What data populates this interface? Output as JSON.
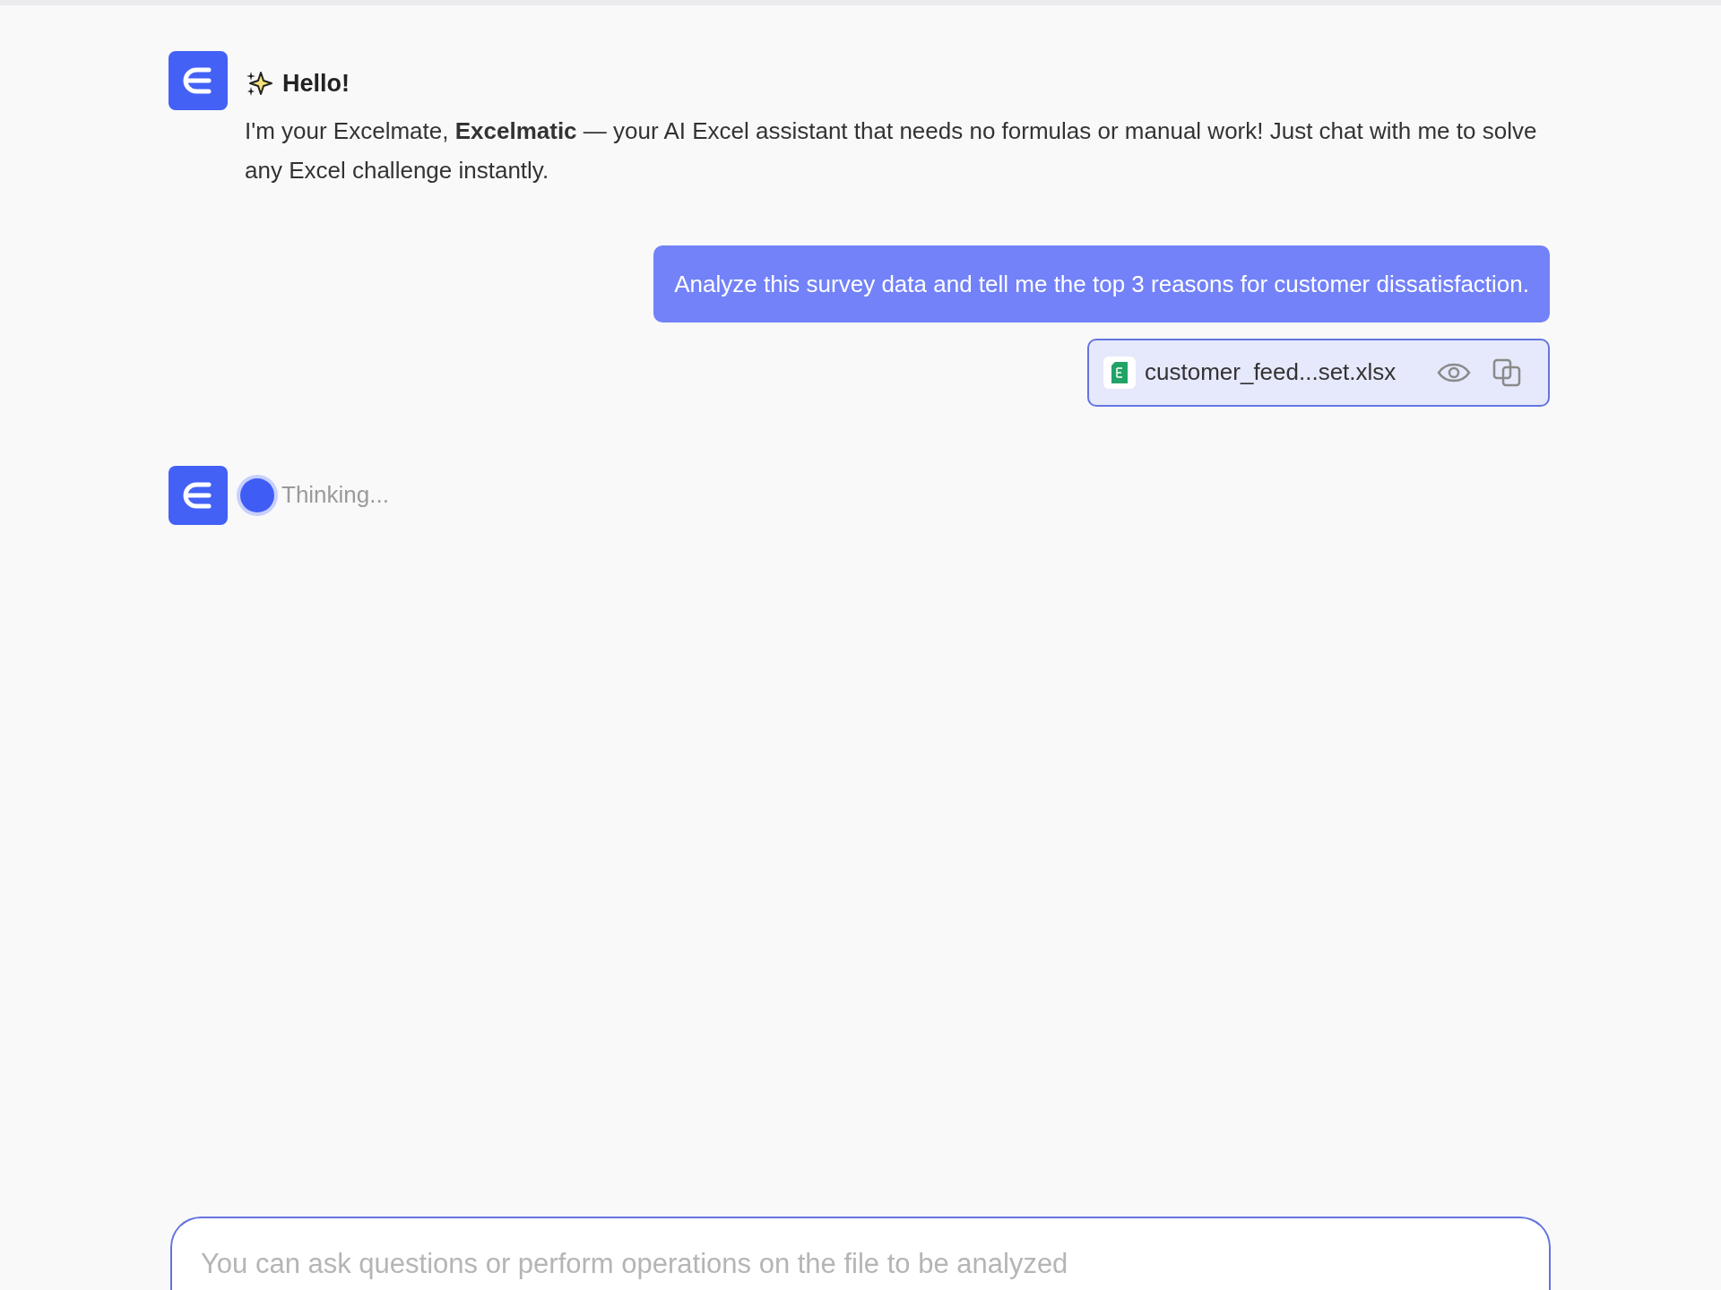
{
  "greeting": {
    "title": "Hello!",
    "body": "I'm your Excelmate, **Excelmatic** — your AI Excel assistant that needs no formulas or manual work! Just chat with me to solve any Excel challenge instantly."
  },
  "user_message": {
    "text": "Analyze this survey data and tell me the top 3 reasons for customer dissatisfaction.",
    "attachment": {
      "file_name": "customer_feed...set.xlsx"
    }
  },
  "status": {
    "text": "Thinking..."
  },
  "composer": {
    "placeholder": "You can ask questions or perform operations on the file to be analyzed"
  }
}
